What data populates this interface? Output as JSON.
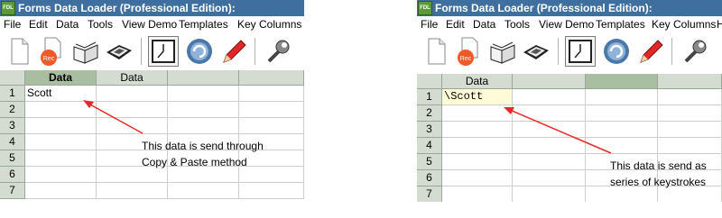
{
  "app": {
    "icon_text": "FDL",
    "title": "Forms Data Loader (Professional Edition):"
  },
  "menu": [
    "File",
    "Edit",
    "Data",
    "Tools",
    "View Demo",
    "Templates",
    "Key Columns",
    "H"
  ],
  "toolbar_icons": [
    "new-document-icon",
    "record-icon",
    "open-book-icon",
    "keyboard-icon",
    "time-delay-icon",
    "refresh-icon",
    "pencil-icon",
    "wrench-icon"
  ],
  "colors": {
    "title_bar": "#3f6f9f",
    "grid_header": "#d4dbd0",
    "selected_header": "#a9bda0",
    "keystroke_cell": "#fffbd8",
    "arrow": "#e8282a"
  },
  "left_panel": {
    "columns": [
      "Data",
      "Data"
    ],
    "rows": [
      "1",
      "2",
      "3",
      "4",
      "5",
      "6",
      "7"
    ],
    "cell_value": "Scott",
    "annotation": [
      "This data is send through",
      "Copy & Paste method"
    ]
  },
  "right_panel": {
    "columns": [
      "Data"
    ],
    "rows": [
      "1",
      "2",
      "3",
      "4",
      "5",
      "6",
      "7"
    ],
    "cell_value": "\\Scott",
    "annotation": [
      "This data is send as",
      "series of keystrokes"
    ]
  }
}
